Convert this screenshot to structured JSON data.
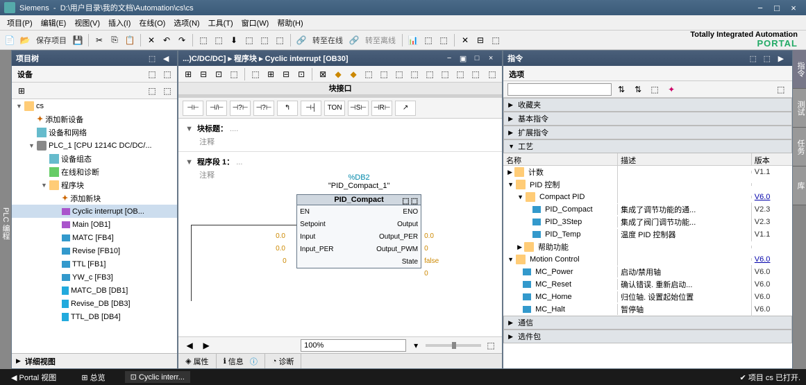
{
  "window": {
    "app": "Siemens",
    "path": "D:\\用户目录\\我的文档\\Automation\\cs\\cs"
  },
  "menu": [
    "项目(P)",
    "编辑(E)",
    "视图(V)",
    "插入(I)",
    "在线(O)",
    "选项(N)",
    "工具(T)",
    "窗口(W)",
    "帮助(H)"
  ],
  "toolbar": {
    "save": "保存项目",
    "go_online": "转至在线",
    "go_offline": "转至离线"
  },
  "brand": {
    "l1": "Totally Integrated Automation",
    "l2": "PORTAL"
  },
  "left_panel": {
    "title": "项目树",
    "sub": "设备",
    "detail": "详细视图",
    "tree": {
      "root": "cs",
      "add_device": "添加新设备",
      "dev_net": "设备和网络",
      "plc": "PLC_1 [CPU 1214C DC/DC/...",
      "dev_cfg": "设备组态",
      "online_diag": "在线和诊断",
      "prog_blocks": "程序块",
      "add_block": "添加新块",
      "blocks": [
        "Cyclic interrupt [OB...",
        "Main [OB1]",
        "MATC [FB4]",
        "Revise [FB10]",
        "TTL [FB1]",
        "YW_c [FB3]",
        "MATC_DB [DB1]",
        "Revise_DB [DB3]",
        "TTL_DB [DB4]"
      ]
    }
  },
  "side_tabs": {
    "left": "PLC 编程",
    "right": [
      "指令",
      "测试",
      "任务",
      "库"
    ]
  },
  "center": {
    "breadcrumb": "...)C/DC/DC]  ▸  程序块  ▸  Cyclic interrupt [OB30]",
    "iface": "块接口",
    "palette": [
      "⊣⊢",
      "⊣/⊢",
      "⊣?⊢",
      "⊣?⊢",
      "↰",
      "⊣┤",
      "TON",
      "⊣S⊢",
      "⊣R⊢",
      "↗"
    ],
    "sec1": {
      "title": "块标题：",
      "dots": "....",
      "comment": "注释"
    },
    "sec2": {
      "title": "程序段 1：",
      "dots": "...",
      "comment": "注释"
    },
    "fb": {
      "db_sym": "%DB2",
      "db_name": "\"PID_Compact_1\"",
      "name": "PID_Compact",
      "left": [
        "EN",
        "Setpoint",
        "Input",
        "Input_PER"
      ],
      "right": [
        "ENO",
        "Output",
        "Output_PER",
        "Output_PWM",
        "State"
      ],
      "left_pins": [
        "",
        "0.0",
        "0.0",
        "0"
      ],
      "right_pins": [
        "",
        "0.0",
        "0",
        "false",
        "0"
      ]
    },
    "zoom": "100%",
    "tabs": [
      "属性",
      "信息",
      "诊断"
    ]
  },
  "right": {
    "title": "指令",
    "options": "选项",
    "accordion": [
      "收藏夹",
      "基本指令",
      "扩展指令",
      "工艺",
      "通信",
      "选件包"
    ],
    "cols": {
      "name": "名称",
      "desc": "描述",
      "ver": "版本"
    },
    "tech": {
      "counting": {
        "n": "计数",
        "v": "V1.1"
      },
      "pid": "PID 控制",
      "cpid": {
        "n": "Compact PID",
        "v": "V6.0"
      },
      "items": [
        {
          "n": "PID_Compact",
          "d": "集成了调节功能的通...",
          "v": "V2.3"
        },
        {
          "n": "PID_3Step",
          "d": "集成了阀门调节功能...",
          "v": "V2.3"
        },
        {
          "n": "PID_Temp",
          "d": "温度 PID 控制器",
          "v": "V1.1"
        }
      ],
      "help": "帮助功能",
      "motion": {
        "n": "Motion Control",
        "v": "V6.0"
      },
      "mc": [
        {
          "n": "MC_Power",
          "d": "启动/禁用轴",
          "v": "V6.0"
        },
        {
          "n": "MC_Reset",
          "d": "确认错误. 重新启动...",
          "v": "V6.0"
        },
        {
          "n": "MC_Home",
          "d": "归位轴. 设置起始位置",
          "v": "V6.0"
        },
        {
          "n": "MC_Halt",
          "d": "暂停轴",
          "v": "V6.0"
        }
      ]
    }
  },
  "status": {
    "portal": "Portal 视图",
    "overview": "总览",
    "current": "Cyclic interr...",
    "proj": "项目 cs 已打开."
  }
}
